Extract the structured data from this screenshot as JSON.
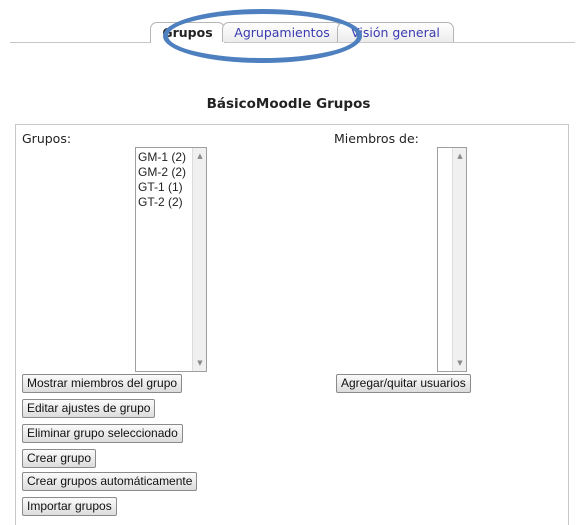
{
  "tabs": {
    "grupos": "Grupos",
    "agrupamientos": "Agrupamientos",
    "vision_general": "Visión general"
  },
  "heading": "BásicoMoodle Grupos",
  "groups_panel": {
    "label": "Grupos:",
    "items": [
      "GM-1 (2)",
      "GM-2 (2)",
      "GT-1 (1)",
      "GT-2 (2)"
    ],
    "buttons": {
      "show_members": "Mostrar miembros del grupo",
      "edit_settings": "Editar ajustes de grupo",
      "delete_selected": "Eliminar grupo seleccionado",
      "create_group": "Crear grupo",
      "auto_create": "Crear grupos automáticamente",
      "import_groups": "Importar grupos"
    }
  },
  "members_panel": {
    "label": "Miembros de:",
    "add_remove_button": "Agregar/quitar usuarios"
  },
  "colors": {
    "highlight_ring": "#4e7fbf",
    "tab_link": "#3a3ab0"
  }
}
